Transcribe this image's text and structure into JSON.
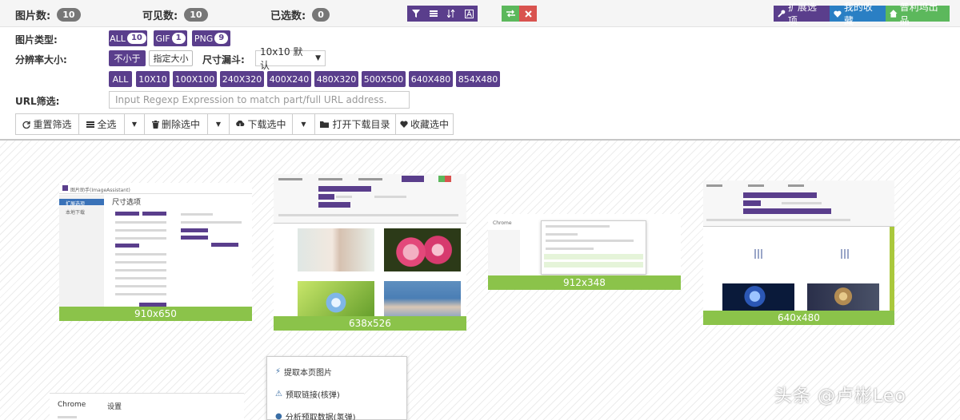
{
  "stats": {
    "total_label": "图片数:",
    "total_count": "10",
    "visible_label": "可见数:",
    "visible_count": "10",
    "selected_label": "已选数:",
    "selected_count": "0"
  },
  "top_right": {
    "extend_label": "扩展选项",
    "favorites_label": "我的收藏",
    "puli_label": "普利坞出品"
  },
  "filters": {
    "type_label": "图片类型:",
    "types": [
      {
        "label": "ALL",
        "count": "10"
      },
      {
        "label": "GIF",
        "count": "1"
      },
      {
        "label": "PNG",
        "count": "9"
      }
    ],
    "resolution_label": "分辨率大小:",
    "not_smaller_label": "不小于",
    "specify_size_label": "指定大小",
    "size_funnel_label": "尺寸漏斗:",
    "size_funnel_value": "10x10 默认",
    "sizes": [
      "ALL",
      "10X10",
      "100X100",
      "240X320",
      "400X240",
      "480X320",
      "500X500",
      "640X480",
      "854X480"
    ],
    "url_label": "URL筛选:",
    "url_placeholder": "Input Regexp Expression to match part/full URL address."
  },
  "actions": {
    "reset_label": "重置筛选",
    "select_all_label": "全选",
    "delete_label": "删除选中",
    "download_label": "下载选中",
    "open_dir_label": "打开下载目录",
    "favorite_label": "收藏选中"
  },
  "thumbnails": [
    {
      "caption": "910x650"
    },
    {
      "caption": "638x526"
    },
    {
      "caption": "912x348"
    },
    {
      "caption": "640x480"
    }
  ],
  "thumb1_text": {
    "title": "图片助手(ImageAssistant)",
    "header": "尺寸选项",
    "side1": "扩展选项",
    "side2": "本地下载"
  },
  "thumb3_text": {
    "chrome": "Chrome"
  },
  "context_menu": {
    "item1": "提取本页图片",
    "item2": "预取链接(核弹)",
    "item3": "分析预取数据(氢弹)"
  },
  "chrome_settings": {
    "chrome": "Chrome",
    "settings": "设置"
  },
  "watermark": "头条 @卢彬Leo",
  "colors": {
    "accent_purple": "#5a3e8c",
    "caption_green": "#8bc34a",
    "confirm_green": "#5cb85c",
    "cancel_red": "#d9534f"
  },
  "icons": [
    "filter-icon",
    "list-icon",
    "sort-icon",
    "text-icon",
    "swap-icon",
    "close-icon",
    "wrench-icon",
    "heart-icon",
    "home-icon",
    "refresh-icon",
    "trash-icon",
    "download-icon",
    "folder-icon"
  ]
}
